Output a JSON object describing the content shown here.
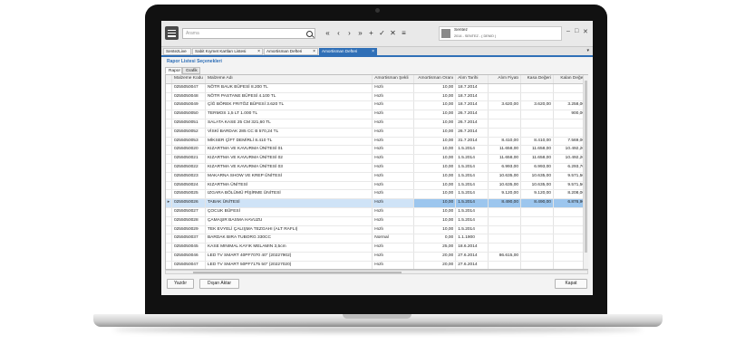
{
  "search": {
    "placeholder": "Arama"
  },
  "toolbar": [
    "«",
    "‹",
    "›",
    "»",
    "+",
    "✓",
    "✕",
    "≡"
  ],
  "user": {
    "name": "Sentez",
    "detail": "2014 - SENTEZ - ( DEMO )"
  },
  "window_controls": [
    "–",
    "□",
    "✕"
  ],
  "tabs": [
    {
      "label": "SentezLive",
      "active": false,
      "closable": false
    },
    {
      "label": "Sabit Kıymet Kartları Listesi",
      "active": false,
      "closable": true
    },
    {
      "label": "Amortisman Defteri",
      "active": false,
      "closable": true
    },
    {
      "label": "Amortisman Defteri",
      "active": true,
      "closable": true
    }
  ],
  "section_title": "Rapor Listesi Seçenekleri",
  "subtabs": [
    {
      "label": "Rapor",
      "active": true
    },
    {
      "label": "Grafik",
      "active": false
    }
  ],
  "table": {
    "columns": [
      "Malzeme Kodu",
      "Malzeme Adı",
      "Amortisman Şekli",
      "Amortisman Oranı",
      "Alım Tarihi",
      "Alım Fiyatı",
      "Kasa Değeri",
      "Kalan Değer"
    ],
    "rows": [
      [
        "0255050047",
        "NÖTR BAUK BÜFESİ 8.200 TL",
        "Hızlı",
        "10,00",
        "18.7.2014",
        "",
        "",
        ""
      ],
      [
        "0255050048",
        "NÖTR PASTANE BÜFESİ  4.100 TL",
        "Hızlı",
        "10,00",
        "18.7.2014",
        "",
        "",
        ""
      ],
      [
        "0255050049",
        "ÇİĞ BÖREK FRITÖZ BÜFESİ 3.620 TL",
        "Hızlı",
        "10,00",
        "18.7.2014",
        "3.620,00",
        "3.620,00",
        "3.258,00"
      ],
      [
        "0255050050",
        "TERMOS 1,5 LT 1.000 TL",
        "Hızlı",
        "10,00",
        "26.7.2014",
        "",
        "",
        "900,00"
      ],
      [
        "0255050051",
        "SALATA KASE 25 CM    321,60 TL",
        "Hızlı",
        "10,00",
        "26.7.2014",
        "",
        "",
        ""
      ],
      [
        "0255050052",
        "VİSKİ BARDAK 285 CC B    570,24 TL",
        "Hızlı",
        "10,00",
        "26.7.2014",
        "",
        "",
        ""
      ],
      [
        "0255050053",
        "MİKSER ÇİFT DEMİRLİ 8.410 TL",
        "Hızlı",
        "10,00",
        "31.7.2014",
        "8.410,00",
        "8.410,00",
        "7.569,00"
      ],
      [
        "0255050020",
        "KIZARTMA VE KAVURMA ÜNİTESİ 01",
        "Hızlı",
        "10,00",
        "1.5.2014",
        "11.658,00",
        "11.658,00",
        "10.492,20"
      ],
      [
        "0255050021",
        "KIZARTMA VE KAVURMA ÜNİTESİ 02",
        "Hızlı",
        "10,00",
        "1.5.2014",
        "11.658,00",
        "11.658,00",
        "10.492,20"
      ],
      [
        "0255050022",
        "KIZARTMA VE KAVURMA ÜNİTESİ 03",
        "Hızlı",
        "10,00",
        "1.5.2014",
        "6.993,00",
        "6.993,00",
        "6.293,70"
      ],
      [
        "0255050023",
        "MAKARNA SHOW VE KREP ÜNİTESİ",
        "Hızlı",
        "10,00",
        "1.5.2014",
        "10.635,00",
        "10.635,00",
        "9.571,50"
      ],
      [
        "0255050024",
        "KIZARTMA ÜNİTESİ",
        "Hızlı",
        "10,00",
        "1.5.2014",
        "10.635,00",
        "10.635,00",
        "9.571,50"
      ],
      [
        "0255050025",
        "IZGARA BÖLÜMÜ PİŞİRME ÜNİTESİ",
        "Hızlı",
        "10,00",
        "1.5.2014",
        "9.120,00",
        "9.120,00",
        "8.208,00"
      ],
      [
        "0255050026",
        "TABAK ÜNİTESİ",
        "Hızlı",
        "10,00",
        "1.5.2014",
        "8.490,00",
        "8.490,00",
        "6.876,90"
      ],
      [
        "0255050027",
        "ÇOCUK BÜFESİ",
        "Hızlı",
        "10,00",
        "1.5.2014",
        "",
        "",
        ""
      ],
      [
        "0255050028",
        "ÇAMAŞIR BASMA HAVUZU",
        "Hızlı",
        "10,00",
        "1.5.2014",
        "",
        "",
        ""
      ],
      [
        "0255050029",
        "TEK EVYELİ ÇALIŞMA TEZGAHI (ALT RAFLI)",
        "Hızlı",
        "10,00",
        "1.5.2014",
        "",
        "",
        ""
      ],
      [
        "0255050037",
        "BARDAK BIRA TUBORG 330CC",
        "Normal",
        "0,00",
        "1.1.1900",
        "",
        "",
        ""
      ],
      [
        "0255050045",
        "KASE MINIMAL KAYIK MELAMIN 3,5cm",
        "Hızlı",
        "25,00",
        "18.6.2014",
        "",
        "",
        ""
      ],
      [
        "0255050046",
        "LED TV SMART 40PF7070 40\" (20227902)",
        "Hızlı",
        "20,00",
        "27.6.2014",
        "86.615,00",
        "",
        ""
      ],
      [
        "0255050047",
        "LED TV SMART 50PF7175 50\" (20227020)",
        "Hızlı",
        "20,00",
        "27.6.2014",
        "",
        "",
        ""
      ]
    ],
    "selected_row": 13
  },
  "buttons": {
    "print": "Yazdır",
    "export": "Dışarı Aktar",
    "close": "Kapat"
  }
}
